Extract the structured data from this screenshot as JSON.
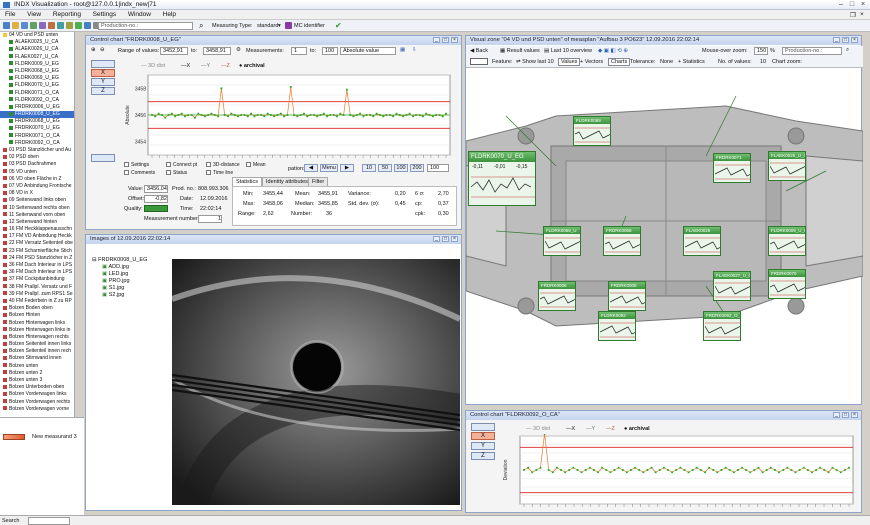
{
  "app": {
    "title": "INDX Visualization",
    "connection": "root@127.0.0.1|indx_new|71"
  },
  "menu": [
    "File",
    "View",
    "Reporting",
    "Settings",
    "Window",
    "Help"
  ],
  "toolbar": {
    "production_placeholder": "Production-no.:",
    "measuring_type_label": "Measuring Type:",
    "measuring_type_value": "standard",
    "mc_identifier": "MC identifier"
  },
  "tree": {
    "items": [
      {
        "label": "04 VD und PSD unten",
        "color": "#f4c542"
      },
      {
        "label": "ALAEK0025_U_CA",
        "color": "#2e8b2e"
      },
      {
        "label": "ALAEK0026_U_CA",
        "color": "#2e8b2e"
      },
      {
        "label": "FLAEK0027_U_CA",
        "color": "#2e8b2e"
      },
      {
        "label": "FLDRK0009_U_EG",
        "color": "#2e8b2e"
      },
      {
        "label": "FLDRK0068_U_EG",
        "color": "#2e8b2e"
      },
      {
        "label": "FLDRK0069_U_EG",
        "color": "#2e8b2e"
      },
      {
        "label": "FLDRK0070_U_EG",
        "color": "#2e8b2e"
      },
      {
        "label": "FLDRK0071_O_CA",
        "color": "#2e8b2e"
      },
      {
        "label": "FLDRK0092_O_CA",
        "color": "#2e8b2e"
      },
      {
        "label": "FRDRK0006_U_EG",
        "color": "#2e8b2e"
      },
      {
        "label": "FRDRK0008_U_EG",
        "color": "#2e8b2e",
        "selected": true
      },
      {
        "label": "FRDRK0068_U_EG",
        "color": "#2e8b2e"
      },
      {
        "label": "FRDRK0070_U_EG",
        "color": "#2e8b2e"
      },
      {
        "label": "FRDRK0071_O_CA",
        "color": "#2e8b2e"
      },
      {
        "label": "FRDRK0092_O_CA",
        "color": "#2e8b2e"
      },
      {
        "label": "01 PSD Stanzlöcher und Au",
        "color": "#c04040"
      },
      {
        "label": "02 PSD oben",
        "color": "#c04040"
      },
      {
        "label": "03 PSD Dachrahmen",
        "color": "#c04040"
      },
      {
        "label": "05 VD unten",
        "color": "#c04040"
      },
      {
        "label": "06 VD oben Fläche in Z",
        "color": "#c04040"
      },
      {
        "label": "07 VD Anbindung Frontsche",
        "color": "#c04040"
      },
      {
        "label": "08 VD in X",
        "color": "#c04040"
      },
      {
        "label": "09 Seitenwand links oben",
        "color": "#c04040"
      },
      {
        "label": "10 Seitenwand rechts oben",
        "color": "#c04040"
      },
      {
        "label": "11 Seitenwand vorn oben",
        "color": "#c04040"
      },
      {
        "label": "12 Seitenwand hinten",
        "color": "#c04040"
      },
      {
        "label": "16 FM Heckklappenausschn",
        "color": "#c04040"
      },
      {
        "label": "17 FM VD Anbindung Heckk",
        "color": "#c04040"
      },
      {
        "label": "22 FM Versatz Seitenteil obe",
        "color": "#c04040"
      },
      {
        "label": "23 FM Scharnierfläche Stich",
        "color": "#c04040"
      },
      {
        "label": "24 FM PSD Stanzlöcher in Z",
        "color": "#c04040"
      },
      {
        "label": "36 FM Dach Interieur in LPS",
        "color": "#c04040"
      },
      {
        "label": "36 FM Dach Interieur in LPS",
        "color": "#c04040"
      },
      {
        "label": "37 FM Cockpitanbindung",
        "color": "#c04040"
      },
      {
        "label": "38 FM Prallpl. Versatz und F",
        "color": "#c04040"
      },
      {
        "label": "39 FM Prallpl. zum RPS1 Se",
        "color": "#c04040"
      },
      {
        "label": "40 FM Federbein in Z zu RP",
        "color": "#c04040"
      },
      {
        "label": "Bolzen Boden oben",
        "color": "#c04040"
      },
      {
        "label": "Bolzen Hinten",
        "color": "#c04040"
      },
      {
        "label": "Bolzen Hinterwagen links",
        "color": "#c04040"
      },
      {
        "label": "Bolzen Hinterwagen links in",
        "color": "#c04040"
      },
      {
        "label": "Bolzen Hinterwagen rechts",
        "color": "#c04040"
      },
      {
        "label": "Bolzen Seitenteil innen links",
        "color": "#c04040"
      },
      {
        "label": "Bolzen Seitenteil innen rech",
        "color": "#c04040"
      },
      {
        "label": "Bolzen Stirnwand innen",
        "color": "#c04040"
      },
      {
        "label": "Bolzen unten",
        "color": "#c04040"
      },
      {
        "label": "Bolzen unten 2",
        "color": "#c04040"
      },
      {
        "label": "Bolzen unten 3",
        "color": "#c04040"
      },
      {
        "label": "Bolzen Unterboden oben",
        "color": "#c04040"
      },
      {
        "label": "Bolzen Vorderwagen links",
        "color": "#c04040"
      },
      {
        "label": "Bolzen Vorderwagen rechts",
        "color": "#c04040"
      },
      {
        "label": "Bolzen Vorderwagen vorne",
        "color": "#c04040"
      }
    ],
    "new_measurand": "New measurand 3"
  },
  "control_chart": {
    "title": "Control chart \"FRDRK0008_U_EG\"",
    "range_label": "Range of values:",
    "range_from": "3452,91",
    "range_to_label": "to:",
    "range_to": "3458,91",
    "measurements_label": "Measurements:",
    "meas_from": "1",
    "meas_to_label": "to:",
    "meas_to": "100",
    "mode": "Absolute value",
    "legend": [
      "3D dist",
      "X",
      "Y",
      "Z",
      "archival"
    ],
    "axis_buttons": [
      "X",
      "Y",
      "Z"
    ],
    "ylabel": "Absolute",
    "options": [
      "Settings",
      "Comments",
      "Connect pt",
      "Status",
      "3D-distance",
      "Time line",
      "Mean"
    ],
    "menu_btn": "Menu",
    "count_buttons": [
      "10",
      "50",
      "100",
      "200"
    ],
    "count_value": "100",
    "pation_label": "pation:",
    "tabs": [
      "Statistics",
      "Identity attributes",
      "Filter"
    ],
    "left_stats": {
      "value_label": "Value:",
      "value": "3456,04",
      "prod_label": "Prod. no.:",
      "prod": "808.993.306",
      "offset_label": "Offset:",
      "offset": "-0,82",
      "date_label": "Date:",
      "date": "12.09.2016",
      "quality_label": "Quality:",
      "time_label": "Time:",
      "time": "22:02:14",
      "meas_num_label": "Measurement number:",
      "meas_num": "1"
    },
    "stats": {
      "min_label": "Min:",
      "min": "3455,44",
      "mean_label": "Mean:",
      "mean": "3455,91",
      "var_label": "Variance:",
      "var": "0,20",
      "six_label": "6 σ:",
      "six": "2,70",
      "max_label": "Max:",
      "max": "3458,06",
      "median_label": "Median:",
      "median": "3455,85",
      "sd_label": "Std. dev. (σ):",
      "sd": "0,45",
      "cp_label": "cp:",
      "cp": "0,37",
      "range_label": "Range:",
      "range": "2,62",
      "number_label": "Number:",
      "number": "36",
      "cpk_label": "cpk:",
      "cpk": "0,30"
    }
  },
  "chart_data": [
    {
      "type": "line",
      "title": "",
      "ylabel": "Absolute",
      "yticks": [
        "3458",
        "3456",
        "3454"
      ],
      "ylim": [
        3453,
        3459
      ],
      "upper_limit": 3457,
      "lower_limit": 3455,
      "nominal": 3456,
      "series": [
        {
          "name": "3D dist",
          "values": [
            3456.0,
            3455.9,
            3456.1,
            3456.0,
            3455.8,
            3456.0,
            3456.1,
            3455.9,
            3456.0,
            3456.1,
            3455.9,
            3456.0,
            3456.0,
            3455.8,
            3456.1,
            3456.0,
            3455.9,
            3456.0,
            3456.1,
            3456.0,
            3455.9,
            3458.0,
            3456.0,
            3455.9,
            3456.1,
            3456.0,
            3455.9,
            3456.0,
            3456.0,
            3455.9,
            3456.1,
            3455.9,
            3456.0,
            3456.0,
            3455.9,
            3456.1,
            3456.0,
            3455.9,
            3456.0,
            3456.1,
            3455.9,
            3456.0,
            3458.1,
            3456.0,
            3455.9,
            3456.0,
            3456.1,
            3455.9,
            3456.0,
            3456.0,
            3455.9,
            3456.0,
            3456.1,
            3455.9,
            3456.0,
            3456.0,
            3455.9,
            3456.1,
            3456.0,
            3457.9,
            3456.0,
            3455.9,
            3456.0,
            3456.1,
            3455.9,
            3456.0,
            3456.0,
            3455.9,
            3456.1,
            3456.0,
            3455.9,
            3456.0,
            3456.0,
            3455.9,
            3456.1,
            3456.0,
            3455.9,
            3456.0,
            3456.1,
            3455.9,
            3456.0,
            3456.0,
            3455.9,
            3456.1,
            3456.0,
            3455.9,
            3456.0,
            3456.0,
            3455.9,
            3456.1
          ]
        }
      ]
    },
    {
      "type": "line",
      "title": "",
      "ylabel": "Deviation",
      "ylim": [
        -1.5,
        1.5
      ],
      "upper_limit": 1.0,
      "lower_limit": -1.0,
      "series": [
        {
          "name": "3D dist",
          "values": [
            0.0,
            0.1,
            -0.1,
            0.0,
            0.1,
            1.6,
            0.0,
            -0.1,
            0.1,
            0.0,
            -0.1,
            0.0,
            0.1,
            0.0,
            -0.1,
            0.0,
            0.1,
            0.0,
            -0.1,
            0.1,
            0.0,
            -0.1,
            0.0,
            0.1,
            0.0,
            -0.1,
            0.0,
            0.1,
            0.0,
            -0.1,
            0.0,
            0.1,
            -0.1,
            0.0,
            0.1,
            0.0,
            -0.1,
            0.0,
            0.1,
            0.0,
            -0.1,
            0.0,
            0.1,
            0.0,
            -0.1,
            0.1,
            0.0,
            -0.1,
            0.0,
            0.1,
            0.0,
            -0.1,
            0.0,
            0.1,
            0.0,
            -0.1,
            0.0,
            0.1,
            -0.1,
            0.0,
            0.1,
            0.0,
            -0.1,
            0.0,
            0.1,
            0.0,
            -0.1,
            0.0,
            0.1,
            0.0,
            -0.1,
            0.0,
            0.1,
            0.0,
            -0.1,
            0.1,
            0.0,
            -0.1,
            0.0,
            0.1
          ]
        }
      ]
    }
  ],
  "images_panel": {
    "title": "Images of 12.09.2016 22:02:14",
    "root": "FRDRK0008_U_EG",
    "files": [
      "ADD.jpg",
      "LED.jpg",
      "PRO.jpg",
      "S1.jpg",
      "S2.jpg"
    ]
  },
  "visual_zone": {
    "title": "Visual zone \"04 VD und PSD unten\" of measplan \"Aufbau 3 PO623\" 12.09.2016 22:02:14",
    "back": "Back",
    "result_values": "Result values",
    "last10": "Last 10 overview",
    "mouse_zoom_label": "Mouse-over zoom:",
    "mouse_zoom": "150",
    "percent": "%",
    "production_placeholder": "Production-no.:",
    "feature_label": "Feature:",
    "show_last10": "Show last 10",
    "values_btn": "Values",
    "vectors": "Vectors",
    "charts_btn": "Charts",
    "tolerance_label": "Tolerance:",
    "tolerance": "None",
    "statistics": "Statistics",
    "num_values_label": "No. of values:",
    "num_values": "10",
    "chart_zoom_label": "Chart zoom:",
    "cards": [
      "FLDRK0070_U_EG",
      "FLDRK0069",
      "FRDRK0071",
      "FLDRK0068_U",
      "FRDRK0068",
      "FLAEK0026",
      "FLAEK0025_U_CA",
      "FRDRK0006",
      "FRDRK0008",
      "FLAEK0027_U_CA",
      "FRDRK0070",
      "FLDRK0092",
      "FRDRK0092_O_CA",
      "FLDRK0009_U_EG"
    ],
    "big_card": {
      "label": "FLDRK0070_U_EG",
      "v1": "-0,11",
      "v2": "-0,01",
      "v3": "-0,15"
    }
  },
  "control_chart2": {
    "title": "Control chart \"FLDRK0092_O_CA\"",
    "legend": [
      "3D dist",
      "X",
      "Y",
      "Z",
      "archival"
    ],
    "axis_buttons": [
      "X",
      "Y",
      "Z"
    ],
    "ylabel": "Deviation"
  },
  "status": {
    "search_label": "Search"
  }
}
